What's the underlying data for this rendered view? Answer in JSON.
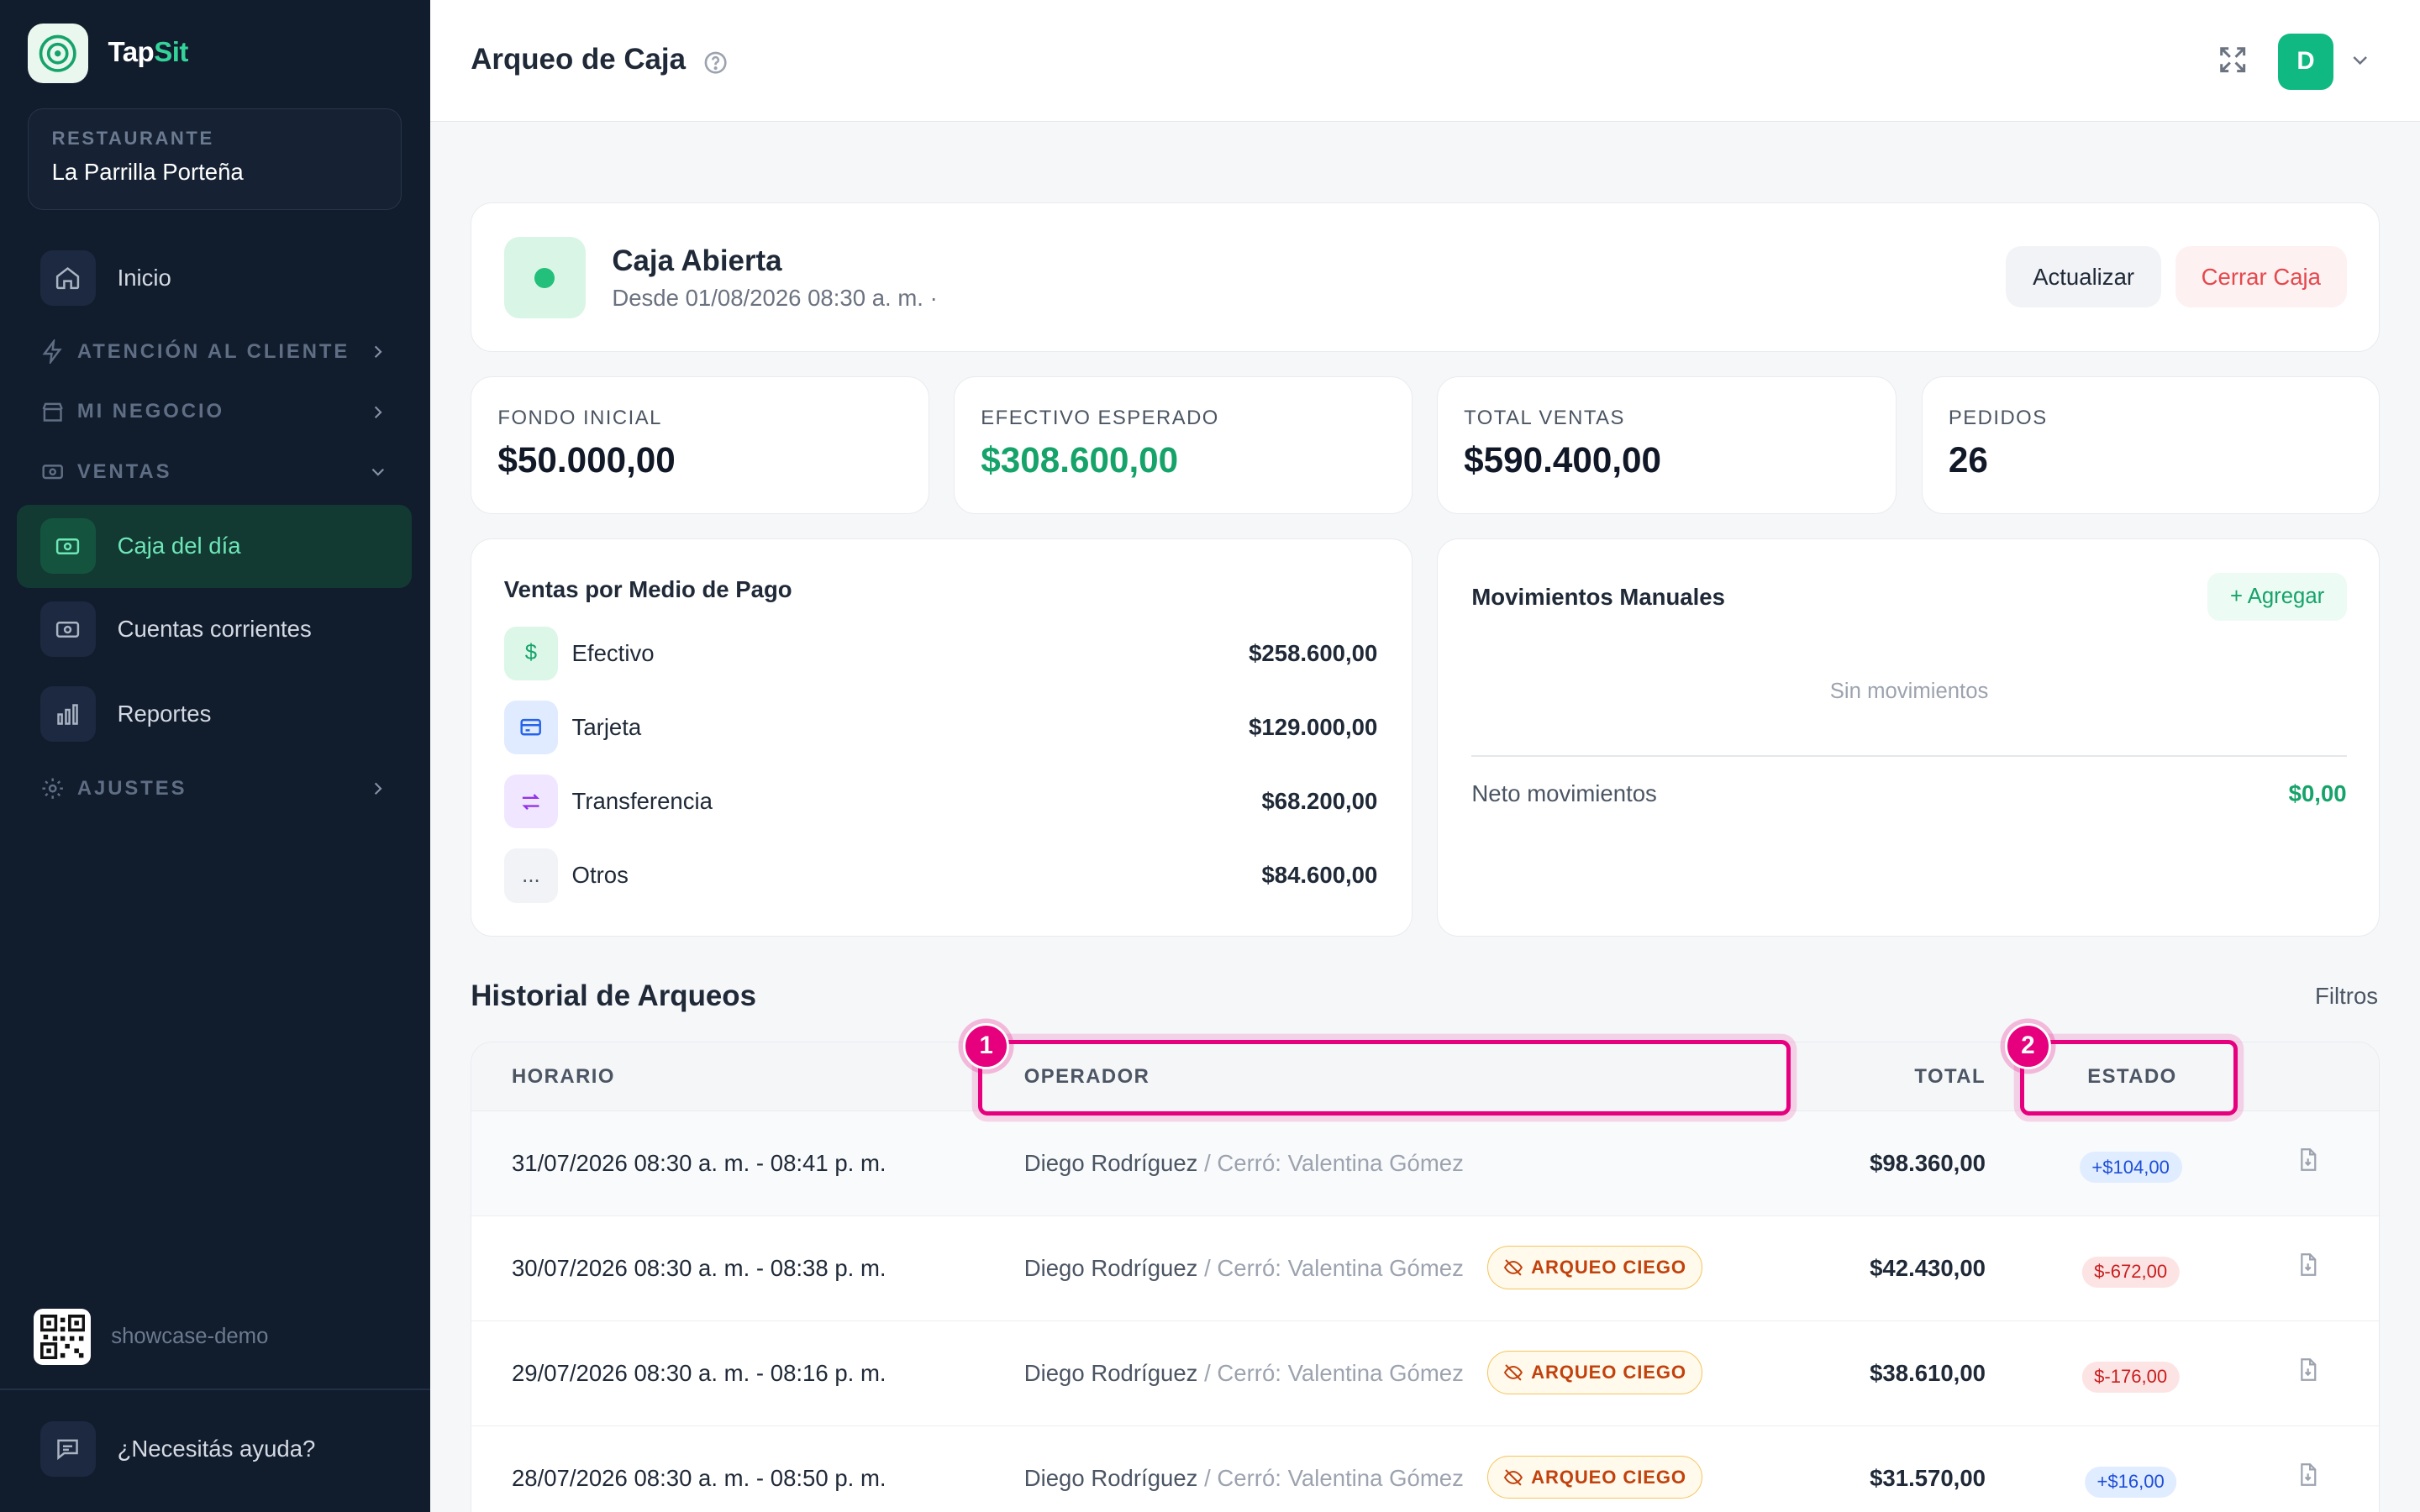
{
  "brand": {
    "name_part1": "Tap",
    "name_part2": "Sit"
  },
  "restaurant": {
    "caption": "RESTAURANTE",
    "name": "La Parrilla Porteña"
  },
  "nav": {
    "inicio": "Inicio",
    "atencion": "ATENCIÓN AL CLIENTE",
    "negocio": "MI NEGOCIO",
    "ventas": "VENTAS",
    "caja": "Caja del día",
    "cuentas": "Cuentas corrientes",
    "reportes": "Reportes",
    "ajustes": "AJUSTES"
  },
  "sidebar_footer": {
    "demo": "showcase-demo",
    "help": "¿Necesitás ayuda?"
  },
  "header": {
    "title": "Arqueo de Caja",
    "avatar_letter": "D"
  },
  "status": {
    "title": "Caja Abierta",
    "subtitle": "Desde 01/08/2026 08:30 a. m. ·",
    "refresh_label": "Actualizar",
    "close_label": "Cerrar Caja"
  },
  "stats": [
    {
      "label": "FONDO INICIAL",
      "value": "$50.000,00"
    },
    {
      "label": "EFECTIVO ESPERADO",
      "value": "$308.600,00"
    },
    {
      "label": "TOTAL VENTAS",
      "value": "$590.400,00"
    },
    {
      "label": "PEDIDOS",
      "value": "26"
    }
  ],
  "payments": {
    "title": "Ventas por Medio de Pago",
    "items": [
      {
        "name": "Efectivo",
        "amount": "$258.600,00",
        "glyph": "$"
      },
      {
        "name": "Tarjeta",
        "amount": "$129.000,00",
        "glyph": ""
      },
      {
        "name": "Transferencia",
        "amount": "$68.200,00",
        "glyph": ""
      },
      {
        "name": "Otros",
        "amount": "$84.600,00",
        "glyph": "..."
      }
    ]
  },
  "movements": {
    "title": "Movimientos Manuales",
    "add_label": "+ Agregar",
    "empty": "Sin movimientos",
    "net_label": "Neto movimientos",
    "net_value": "$0,00"
  },
  "history": {
    "title": "Historial de Arqueos",
    "filters_label": "Filtros",
    "columns": {
      "horario": "HORARIO",
      "operador": "OPERADOR",
      "total": "TOTAL",
      "estado": "ESTADO"
    },
    "blind_label": "ARQUEO CIEGO",
    "rows": [
      {
        "time": "31/07/2026 08:30 a. m. - 08:41 p. m.",
        "operator": "Diego Rodríguez",
        "closed_by": " / Cerró: Valentina Gómez",
        "total": "$98.360,00",
        "diff": "+$104,00"
      },
      {
        "time": "30/07/2026 08:30 a. m. - 08:38 p. m.",
        "operator": "Diego Rodríguez",
        "closed_by": " / Cerró: Valentina Gómez",
        "total": "$42.430,00",
        "diff": "$-672,00"
      },
      {
        "time": "29/07/2026 08:30 a. m. - 08:16 p. m.",
        "operator": "Diego Rodríguez",
        "closed_by": " / Cerró: Valentina Gómez",
        "total": "$38.610,00",
        "diff": "$-176,00"
      },
      {
        "time": "28/07/2026 08:30 a. m. - 08:50 p. m.",
        "operator": "Diego Rodríguez",
        "closed_by": " / Cerró: Valentina Gómez",
        "total": "$31.570,00",
        "diff": "+$16,00"
      }
    ]
  },
  "annotations": {
    "first": "1",
    "second": "2"
  },
  "colors": {
    "accent": "#10b981",
    "sidebar": "#111c2d",
    "highlight": "#e6007e",
    "danger": "#e5484d"
  }
}
